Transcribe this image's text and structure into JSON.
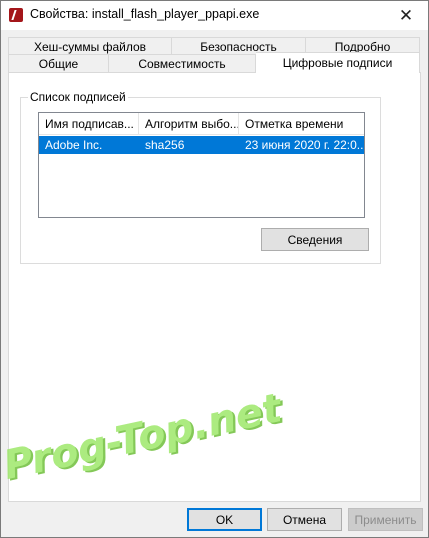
{
  "window": {
    "title": "Свойства: install_flash_player_ppapi.exe",
    "close_glyph": "✕"
  },
  "tabs": {
    "back_row": [
      {
        "label": "Хеш-суммы файлов"
      },
      {
        "label": "Безопасность"
      },
      {
        "label": "Подробно"
      }
    ],
    "front_row": [
      {
        "label": "Общие"
      },
      {
        "label": "Совместимость"
      },
      {
        "label": "Цифровые подписи",
        "active": true
      }
    ]
  },
  "signatures": {
    "group_label": "Список подписей",
    "columns": [
      "Имя подписав...",
      "Алгоритм выбо...",
      "Отметка времени"
    ],
    "rows": [
      {
        "name": "Adobe Inc.",
        "algorithm": "sha256",
        "timestamp": "23 июня 2020 г. 22:0...",
        "selected": true
      }
    ],
    "details_button": "Сведения"
  },
  "footer": {
    "ok": "OK",
    "cancel": "Отмена",
    "apply": "Применить"
  },
  "watermark": "Prog-Top.net",
  "colors": {
    "selection": "#0078d7",
    "watermark": "#9ee86a",
    "app_icon": "#a4161a"
  }
}
